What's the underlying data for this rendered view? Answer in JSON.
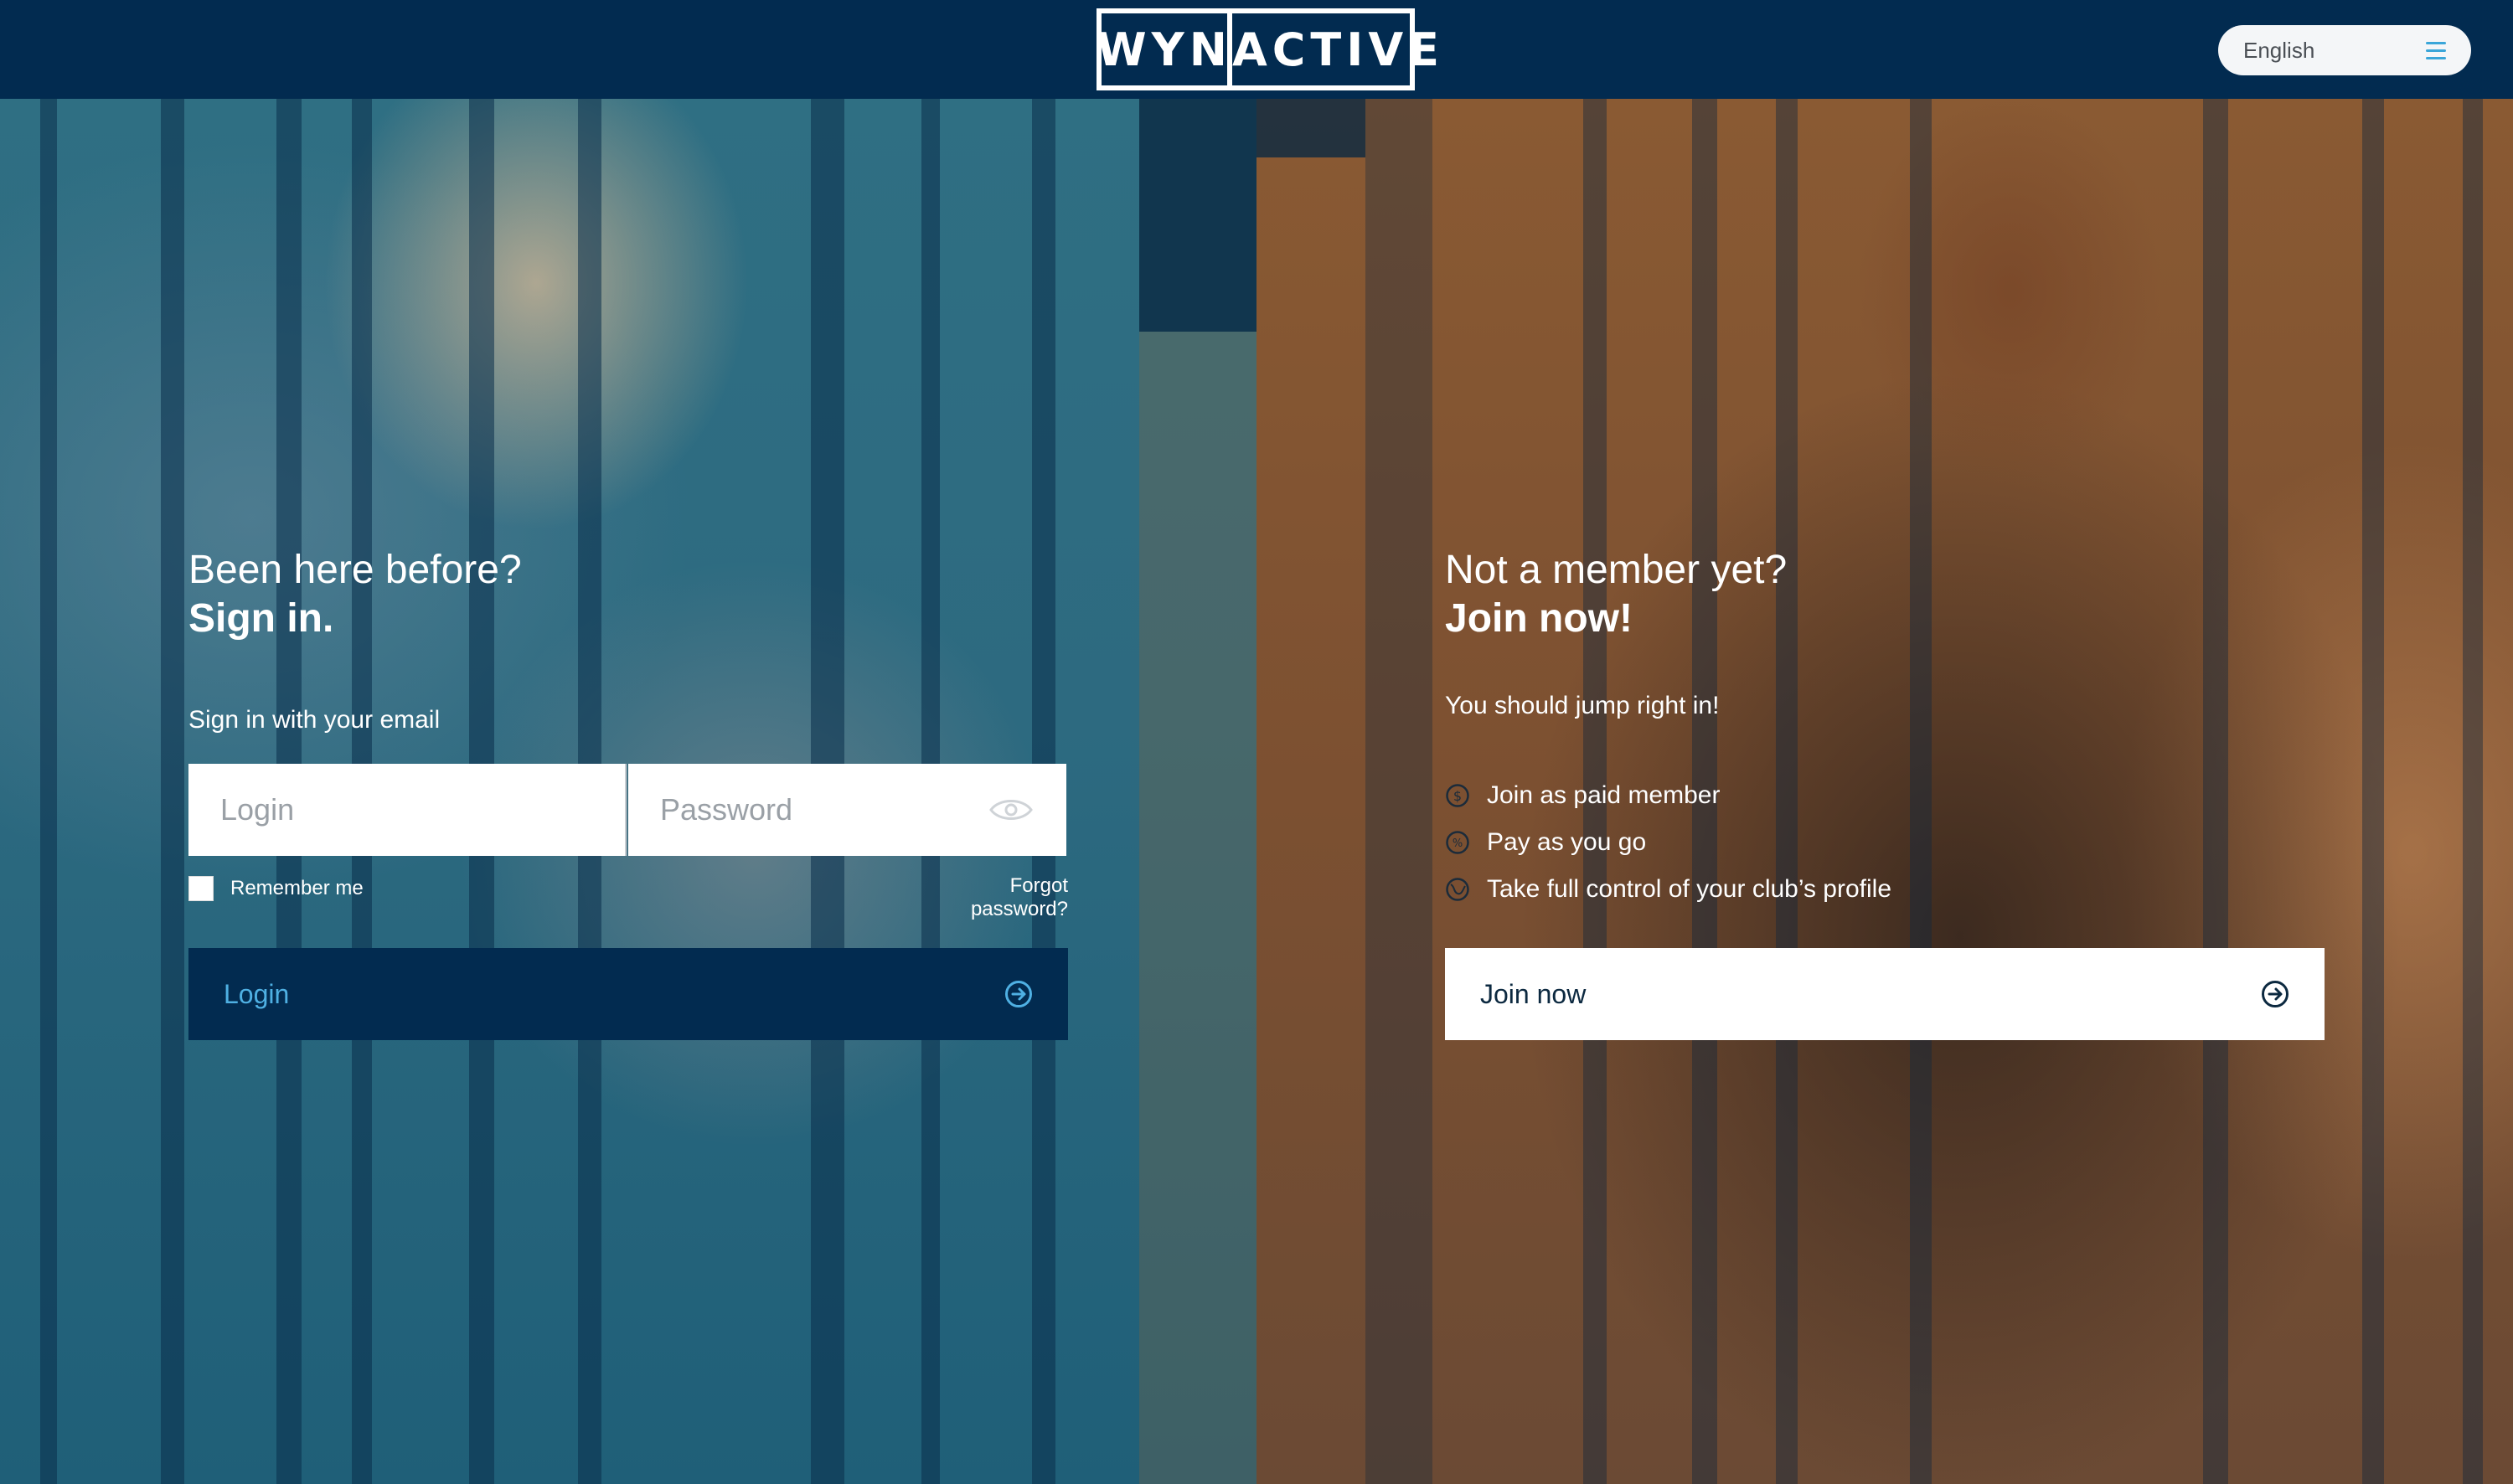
{
  "header": {
    "logo_left": "WYN",
    "logo_right": "ACTIVE",
    "language_label": "English"
  },
  "signin": {
    "headline_line1": "Been here before?",
    "headline_line2": "Sign in.",
    "subheading": "Sign in with your email",
    "login_placeholder": "Login",
    "password_placeholder": "Password",
    "remember_label": "Remember me",
    "forgot_label": "Forgot password?",
    "button_label": "Login"
  },
  "join": {
    "headline_line1": "Not a member yet?",
    "headline_line2": "Join now!",
    "subheading": "You should jump right in!",
    "features": [
      {
        "label": "Join as paid member",
        "icon": "dollar-circle-icon"
      },
      {
        "label": "Pay as you go",
        "icon": "percent-circle-icon"
      },
      {
        "label": "Take full control of your club’s profile",
        "icon": "globe-icon"
      }
    ],
    "button_label": "Join now"
  },
  "colors": {
    "header_bg": "#022b50",
    "login_button_bg": "#022b50",
    "login_button_text": "#4fb0e3",
    "menu_accent": "#3aa6d9"
  }
}
